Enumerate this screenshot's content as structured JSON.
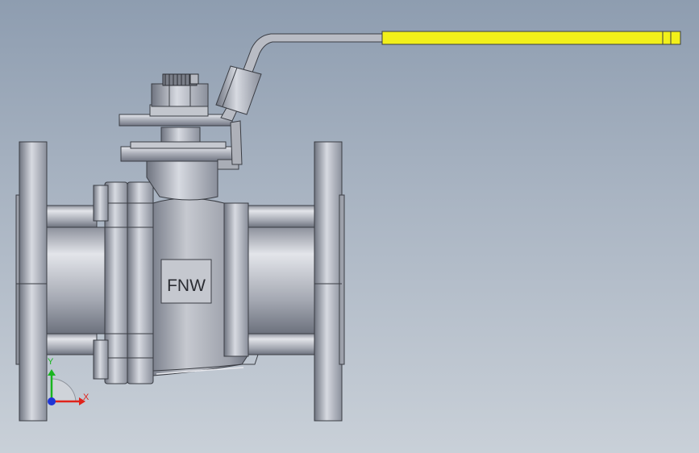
{
  "model": {
    "body_label": "FNW",
    "handle_grip_color": "#f2f01a",
    "metal_color": "#b9bcc4"
  },
  "triad": {
    "x_label": "X",
    "y_label": "Y",
    "x_color": "#e0231b",
    "y_color": "#19b51f",
    "z_color": "#1f35d6"
  }
}
